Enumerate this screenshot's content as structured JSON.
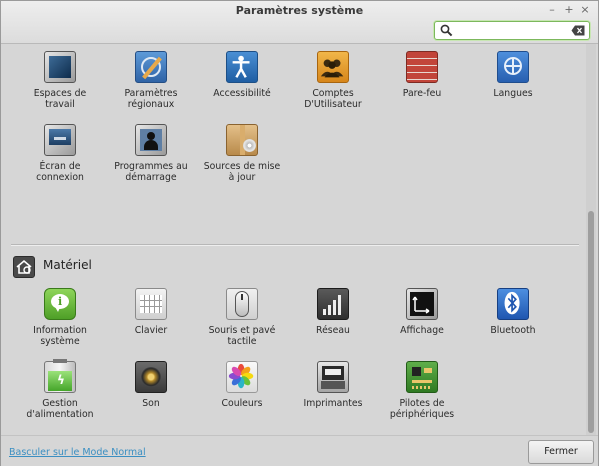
{
  "window": {
    "title": "Paramètres système",
    "controls": {
      "minimize": "–",
      "maximize": "+",
      "close": "×"
    }
  },
  "search": {
    "value": "",
    "placeholder": ""
  },
  "personal": {
    "items": [
      {
        "label": "Espaces de\ntravail",
        "icon": "workspaces-icon"
      },
      {
        "label": "Paramètres\nrégionaux",
        "icon": "regional-settings-icon"
      },
      {
        "label": "Accessibilité",
        "icon": "accessibility-icon"
      },
      {
        "label": "Comptes\nD'Utilisateur",
        "icon": "user-accounts-icon"
      },
      {
        "label": "Pare-feu",
        "icon": "firewall-icon"
      },
      {
        "label": "Langues",
        "icon": "languages-icon"
      },
      {
        "label": "Écran de\nconnexion",
        "icon": "login-screen-icon"
      },
      {
        "label": "Programmes au\ndémarrage",
        "icon": "startup-apps-icon"
      },
      {
        "label": "Sources de mise\nà jour",
        "icon": "software-sources-icon"
      }
    ]
  },
  "hardware": {
    "title": "Matériel",
    "icon": "hardware-section-icon",
    "items": [
      {
        "label": "Information\nsystème",
        "icon": "system-info-icon"
      },
      {
        "label": "Clavier",
        "icon": "keyboard-icon"
      },
      {
        "label": "Souris et pavé\ntactile",
        "icon": "mouse-icon"
      },
      {
        "label": "Réseau",
        "icon": "network-icon"
      },
      {
        "label": "Affichage",
        "icon": "display-icon"
      },
      {
        "label": "Bluetooth",
        "icon": "bluetooth-icon"
      },
      {
        "label": "Gestion\nd'alimentation",
        "icon": "power-icon"
      },
      {
        "label": "Son",
        "icon": "sound-icon"
      },
      {
        "label": "Couleurs",
        "icon": "colors-icon"
      },
      {
        "label": "Imprimantes",
        "icon": "printer-icon"
      },
      {
        "label": "Pilotes de\npériphériques",
        "icon": "drivers-icon"
      }
    ]
  },
  "footer": {
    "link": "Basculer sur le Mode Normal",
    "close_button": "Fermer"
  }
}
